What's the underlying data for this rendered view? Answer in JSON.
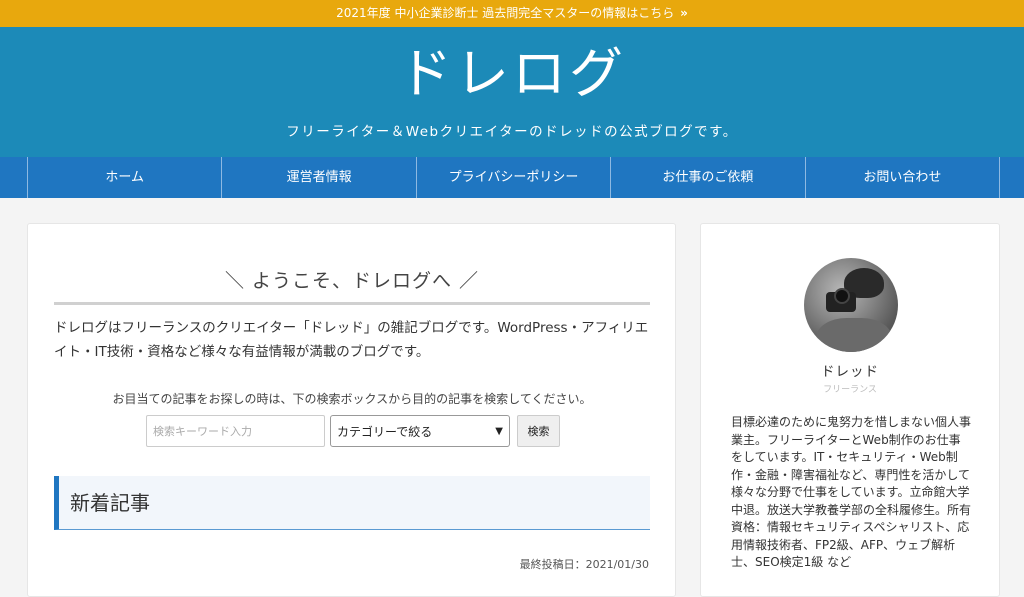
{
  "notice": {
    "text": "2021年度 中小企業診断士 過去問完全マスターの情報はこちら",
    "arrow": "»"
  },
  "header": {
    "title": "ドレログ",
    "tagline": "フリーライター＆Webクリエイターのドレッドの公式ブログです。"
  },
  "nav": {
    "items": [
      {
        "label": "ホーム"
      },
      {
        "label": "運営者情報"
      },
      {
        "label": "プライバシーポリシー"
      },
      {
        "label": "お仕事のご依頼"
      },
      {
        "label": "お問い合わせ"
      }
    ]
  },
  "main": {
    "welcome": "＼ ようこそ、ドレログへ ／",
    "intro": "ドレログはフリーランスのクリエイター「ドレッド」の雑記ブログです。WordPress・アフィリエイト・IT技術・資格など様々な有益情報が満載のブログです。",
    "search_hint": "お目当ての記事をお探しの時は、下の検索ボックスから目的の記事を検索してください。",
    "search": {
      "placeholder": "検索キーワード入力",
      "category_selected": "カテゴリーで絞る",
      "button_label": "検索"
    },
    "section_title": "新着記事",
    "post_date": "最終投稿日：2021/01/30"
  },
  "sidebar": {
    "name": "ドレッド",
    "role": "フリーランス",
    "bio": "目標必達のために鬼努力を惜しまない個人事業主。フリーライターとWeb制作のお仕事をしています。IT・セキュリティ・Web制作・金融・障害福祉など、専門性を活かして様々な分野で仕事をしています。立命館大学中退。放送大学教養学部の全科履修生。所有資格：情報セキュリティスペシャリスト、応用情報技術者、FP2級、AFP、ウェブ解析士、SEO検定1級 など"
  },
  "colors": {
    "notice_bg": "#e8a80d",
    "header_bg": "#1c8ab8",
    "nav_bg": "#1f76c1",
    "accent": "#1f76c1"
  }
}
